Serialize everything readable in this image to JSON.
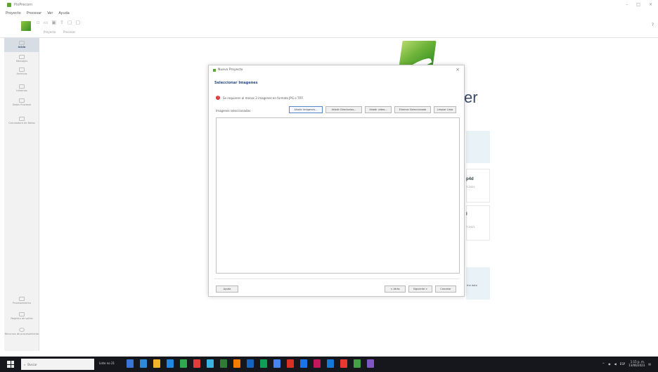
{
  "window": {
    "title": "PixPrecorn",
    "controls": [
      "–",
      "□",
      "×"
    ]
  },
  "menu": [
    "Proyecto",
    "Procesar",
    "Ver",
    "Ayuda"
  ],
  "toolbar": {
    "icons": [
      "new-icon",
      "open-icon",
      "save-icon",
      "export-icon",
      "undo-icon",
      "redo-icon"
    ],
    "group_labels": [
      "Proyecto",
      "Procesar"
    ],
    "help_symbol": "?"
  },
  "sidebar": {
    "top_items": [
      {
        "label": "Inicio",
        "icon": "home-icon",
        "active": true
      },
      {
        "label": "Mensajes",
        "icon": "messages-icon",
        "active": false
      },
      {
        "label": "Archivos",
        "icon": "files-icon",
        "active": false
      },
      {
        "label": "Informes",
        "icon": "reports-icon",
        "active": false
      },
      {
        "label": "Datos Procesar",
        "icon": "data-icon",
        "active": false
      },
      {
        "label": "Calculadora de Datos",
        "icon": "calculator-icon",
        "active": false
      }
    ],
    "bottom_items": [
      {
        "label": "Procesamiento",
        "icon": "processing-icon"
      },
      {
        "label": "Registro de salida",
        "icon": "output-log-icon"
      },
      {
        "label": "Recursos de procesamiento",
        "icon": "resources-icon"
      }
    ]
  },
  "background": {
    "brand_text": "er",
    "card1_title": "p4d",
    "card1_sub": "7.2021",
    "card2_title": "l",
    "card2_sub": "7.2021",
    "panel_text": "the data"
  },
  "dialog": {
    "title": "Nuevo Proyecto",
    "close_symbol": "×",
    "heading": "Seleccionar Imagenes",
    "error_message": "Se requieren al menos 3 imagenes en formato JPG o TIFF.",
    "images_label": "Imagenes seleccionadas:",
    "buttons": {
      "add_images": "Añadir Imágenes...",
      "add_directories": "Añadir Directorios...",
      "add_video": "Añadir vídeo...",
      "remove_selected": "Eliminar Seleccionado",
      "clear_list": "Limpiar Lista"
    },
    "footer": {
      "help": "Ayuda",
      "back": "< Atrás",
      "next": "Siguiente >",
      "cancel": "Cancelar"
    }
  },
  "taskbar": {
    "search_placeholder": "Buscar",
    "app_label": "Listo no 21",
    "icon_colors": [
      "#3b74d6",
      "#2e8ad8",
      "#f0b429",
      "#1e88e5",
      "#2fa84f",
      "#e23d3d",
      "#3bb3e0",
      "#2e7d32",
      "#f57c00",
      "#1565c0",
      "#0f9d58",
      "#4285f4",
      "#d93025",
      "#1a73e8",
      "#c2185b",
      "#1976d2",
      "#e53935",
      "#43a047",
      "#7e57c2"
    ],
    "tray_text": "ESP",
    "time": "1:15 p. m.",
    "date": "13/06/2023"
  }
}
